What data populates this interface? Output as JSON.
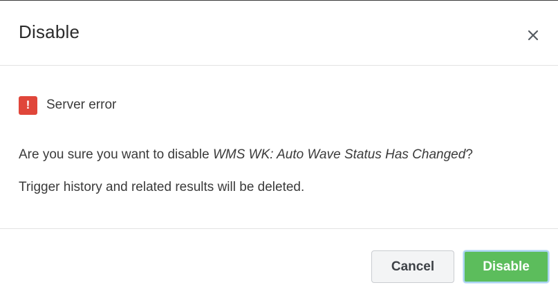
{
  "dialog": {
    "title": "Disable",
    "close_icon": "close-icon"
  },
  "error": {
    "icon": "exclamation-icon",
    "icon_glyph": "!",
    "message": "Server error",
    "color": "#e0463a"
  },
  "confirmation": {
    "prefix": "Are you sure you want to disable ",
    "item_name": "WMS WK: Auto Wave Status Has Changed",
    "suffix": "?",
    "warning": "Trigger history and related results will be deleted."
  },
  "footer": {
    "cancel_label": "Cancel",
    "disable_label": "Disable",
    "disable_color": "#5cbd5c"
  }
}
